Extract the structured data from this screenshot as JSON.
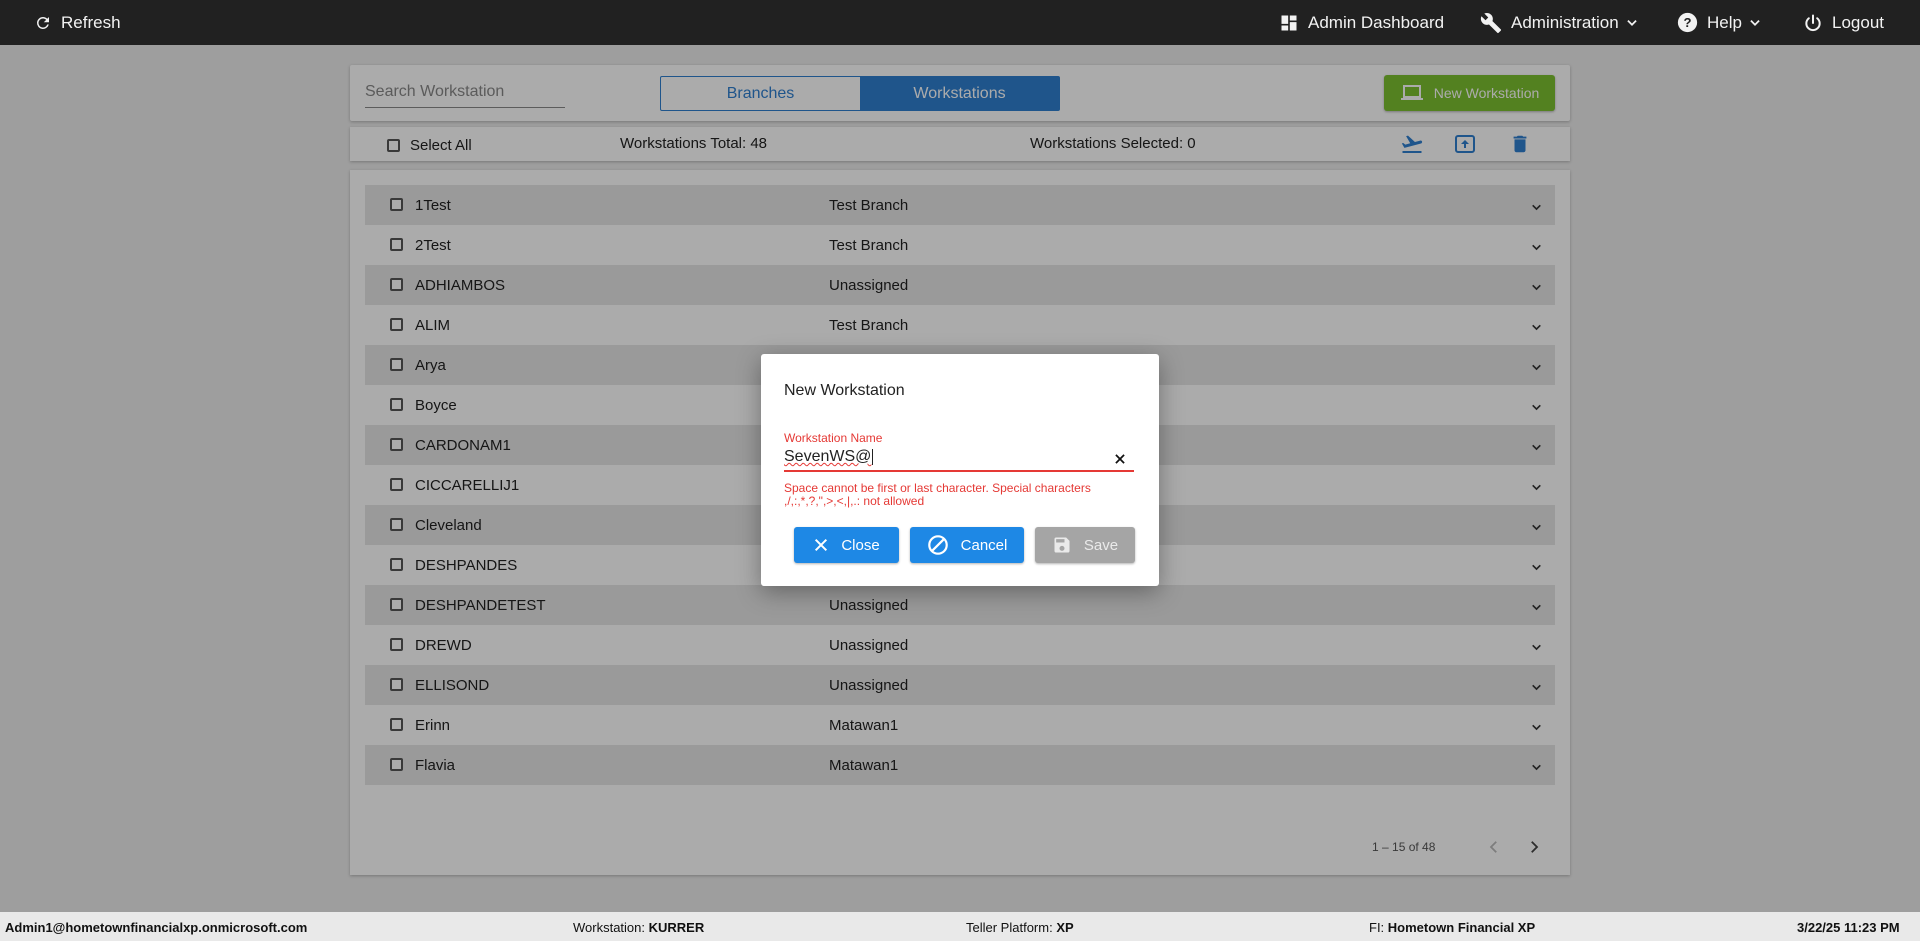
{
  "topbar": {
    "refresh": "Refresh",
    "admin_dashboard": "Admin Dashboard",
    "administration": "Administration",
    "help": "Help",
    "logout": "Logout"
  },
  "toolbar": {
    "search_placeholder": "Search Workstation",
    "tabs": [
      "Branches",
      "Workstations"
    ],
    "active_tab": "Workstations",
    "new_button": "New Workstation"
  },
  "summary": {
    "select_all": "Select All",
    "total": "Workstations Total: 48",
    "selected": "Workstations Selected: 0"
  },
  "rows": [
    {
      "name": "1Test",
      "branch": "Test Branch"
    },
    {
      "name": "2Test",
      "branch": "Test Branch"
    },
    {
      "name": "ADHIAMBOS",
      "branch": "Unassigned"
    },
    {
      "name": "ALIM",
      "branch": "Test Branch"
    },
    {
      "name": "Arya",
      "branch": ""
    },
    {
      "name": "Boyce",
      "branch": ""
    },
    {
      "name": "CARDONAM1",
      "branch": ""
    },
    {
      "name": "CICCARELLIJ1",
      "branch": ""
    },
    {
      "name": "Cleveland",
      "branch": ""
    },
    {
      "name": "DESHPANDES",
      "branch": ""
    },
    {
      "name": "DESHPANDETEST",
      "branch": "Unassigned"
    },
    {
      "name": "DREWD",
      "branch": "Unassigned"
    },
    {
      "name": "ELLISOND",
      "branch": "Unassigned"
    },
    {
      "name": "Erinn",
      "branch": "Matawan1"
    },
    {
      "name": "Flavia",
      "branch": "Matawan1"
    }
  ],
  "pager": {
    "range": "1 – 15 of 48"
  },
  "dialog": {
    "title": "New Workstation",
    "field_label": "Workstation Name",
    "field_value": "SevenWS@",
    "error": "Space cannot be first or last character. Special characters ,/,:,*,?,\",>,<,|,.: not allowed",
    "close": "Close",
    "cancel": "Cancel",
    "save": "Save"
  },
  "statusbar": {
    "user": "Admin1@hometownfinancialxp.onmicrosoft.com",
    "workstation_label": "Workstation: ",
    "workstation_value": "KURRER",
    "platform_label": "Teller Platform: ",
    "platform_value": "XP",
    "fi_label": "FI: ",
    "fi_value": "Hometown Financial XP",
    "datetime": "3/22/25 11:23 PM"
  },
  "colors": {
    "topbar": "#212121",
    "primary": "#2f7fd0",
    "new_button": "#7dc030",
    "error": "#e53935",
    "dialog_button": "#1e88e5",
    "disabled_button": "#a5a5a5"
  }
}
